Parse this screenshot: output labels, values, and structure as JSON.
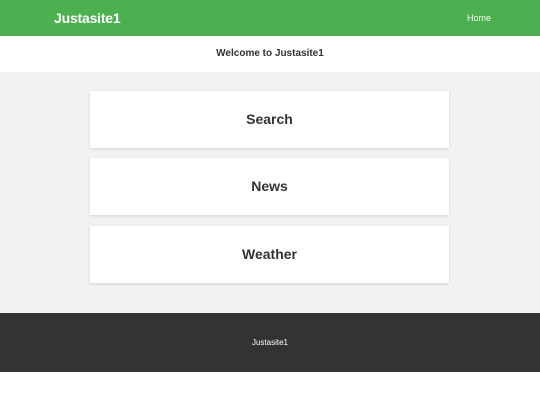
{
  "navbar": {
    "brand": "Justasite1",
    "links": [
      {
        "label": "Home"
      }
    ]
  },
  "welcome": {
    "text": "Welcome to Justasite1"
  },
  "cards": [
    {
      "label": "Search"
    },
    {
      "label": "News"
    },
    {
      "label": "Weather"
    }
  ],
  "footer": {
    "text": "Justasite1"
  },
  "colors": {
    "navbar_bg": "#4caf50",
    "main_bg": "#f2f2f2",
    "footer_bg": "#333333",
    "card_bg": "#ffffff",
    "text": "#333333"
  }
}
